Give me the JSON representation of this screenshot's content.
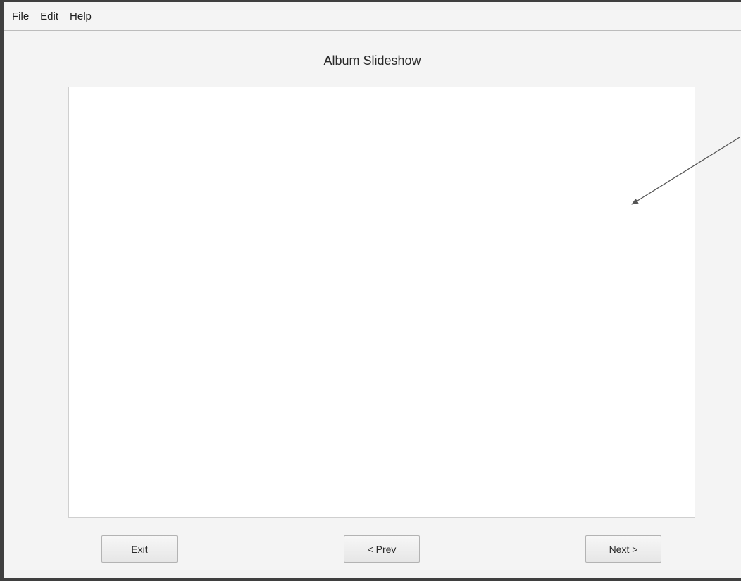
{
  "menubar": {
    "items": [
      {
        "label": "File"
      },
      {
        "label": "Edit"
      },
      {
        "label": "Help"
      }
    ]
  },
  "main": {
    "title": "Album Slideshow"
  },
  "buttons": {
    "exit_label": "Exit",
    "prev_label": "< Prev",
    "next_label": "Next >"
  }
}
